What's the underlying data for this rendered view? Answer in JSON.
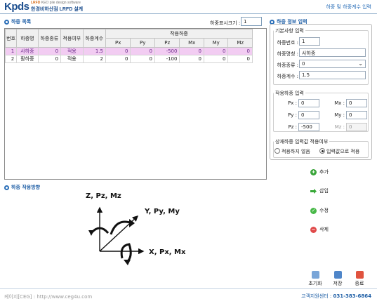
{
  "header": {
    "logo_main": "Kpds",
    "logo_top_1": "LRFD",
    "logo_top_2": "KEO pile design software",
    "logo_sub": "한경비하산점 LRFD 설계",
    "title": "하중 및 하중계수 입력"
  },
  "load_list": {
    "section_title": "하중 목록",
    "size_label": "하중표시크기 :",
    "size_value": "1",
    "columns": [
      "번호",
      "하중명",
      "하중종류",
      "적용여부",
      "하중계수"
    ],
    "applied_group": "작용하중",
    "force_columns": [
      "Px",
      "Py",
      "Pz",
      "Mx",
      "My",
      "Mz"
    ],
    "rows": [
      {
        "no": "1",
        "name": "사하중",
        "type": "0",
        "apply": "적용",
        "factor": "1.5",
        "px": "0",
        "py": "0",
        "pz": "-500",
        "mx": "0",
        "my": "0",
        "mz": "0"
      },
      {
        "no": "2",
        "name": "활하중",
        "type": "0",
        "apply": "적용",
        "factor": "2",
        "px": "0",
        "py": "0",
        "pz": "-100",
        "mx": "0",
        "my": "0",
        "mz": "0"
      }
    ]
  },
  "direction": {
    "section_title": "하중 작용방향",
    "axis_z": "Z, Pz, Mz",
    "axis_y": "Y, Py, My",
    "axis_x": "X, Px, Mx"
  },
  "load_info": {
    "section_title": "하중 정보 입력",
    "basic_group": "기본사항 입력",
    "load_no_label": "하중번호 :",
    "load_no_value": "1",
    "load_name_label": "하중명칭 :",
    "load_name_value": "사하중",
    "load_type_label": "하중종류 :",
    "load_type_value": "0",
    "load_factor_label": "하중계수 :",
    "load_factor_value": "1.5",
    "applied_group": "작용하중 입력",
    "px_label": "Px :",
    "px_value": "0",
    "mx_label": "Mx :",
    "mx_value": "0",
    "py_label": "Py :",
    "py_value": "0",
    "my_label": "My :",
    "my_value": "0",
    "pz_label": "Pz :",
    "pz_value": "-500",
    "mz_label": "Mz :",
    "mz_value": "0",
    "apply_group": "상재하중 입력값 적용여부",
    "option_no": "적용하지 않음",
    "option_yes": "입력값으로 적용"
  },
  "actions": {
    "add": "추가",
    "insert": "삽입",
    "modify": "수정",
    "delete": "삭제"
  },
  "bottom": {
    "reset": "초기화",
    "save": "저장",
    "exit": "종료"
  },
  "footer": {
    "left": "케이지[CEG] : http://www.ceg4u.com",
    "right_label": "고객지원센터 :",
    "right_phone": "031-383-6864"
  },
  "colors": {
    "accent": "#1f5fa6",
    "selected_row": "#f2ccf2",
    "add_icon": "#3aa53a",
    "insert_icon": "#37a837",
    "modify_icon": "#47b847",
    "delete_icon": "#e04a4a"
  }
}
